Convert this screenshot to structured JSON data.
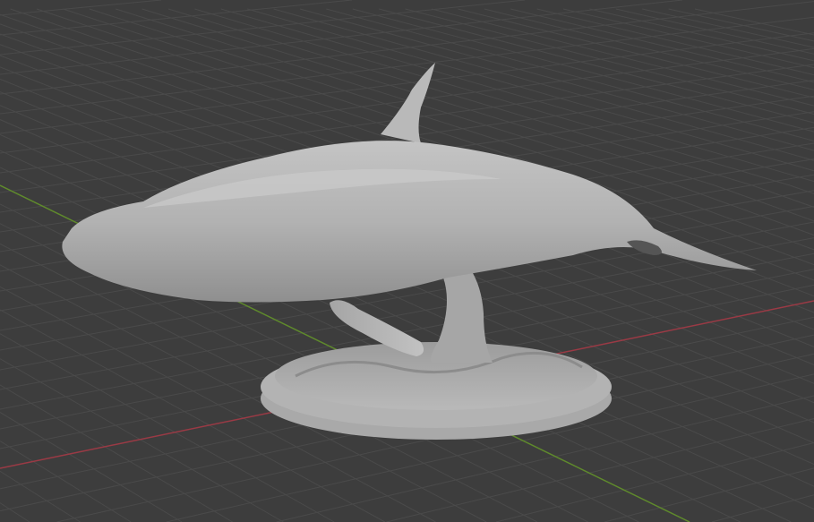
{
  "viewport": {
    "background": "#3d3d3d",
    "grid_color": "#4a4a4a",
    "x_axis_color": "#9a3a45",
    "y_axis_color": "#5f8a2c",
    "model_color": "#b4b4b4"
  }
}
